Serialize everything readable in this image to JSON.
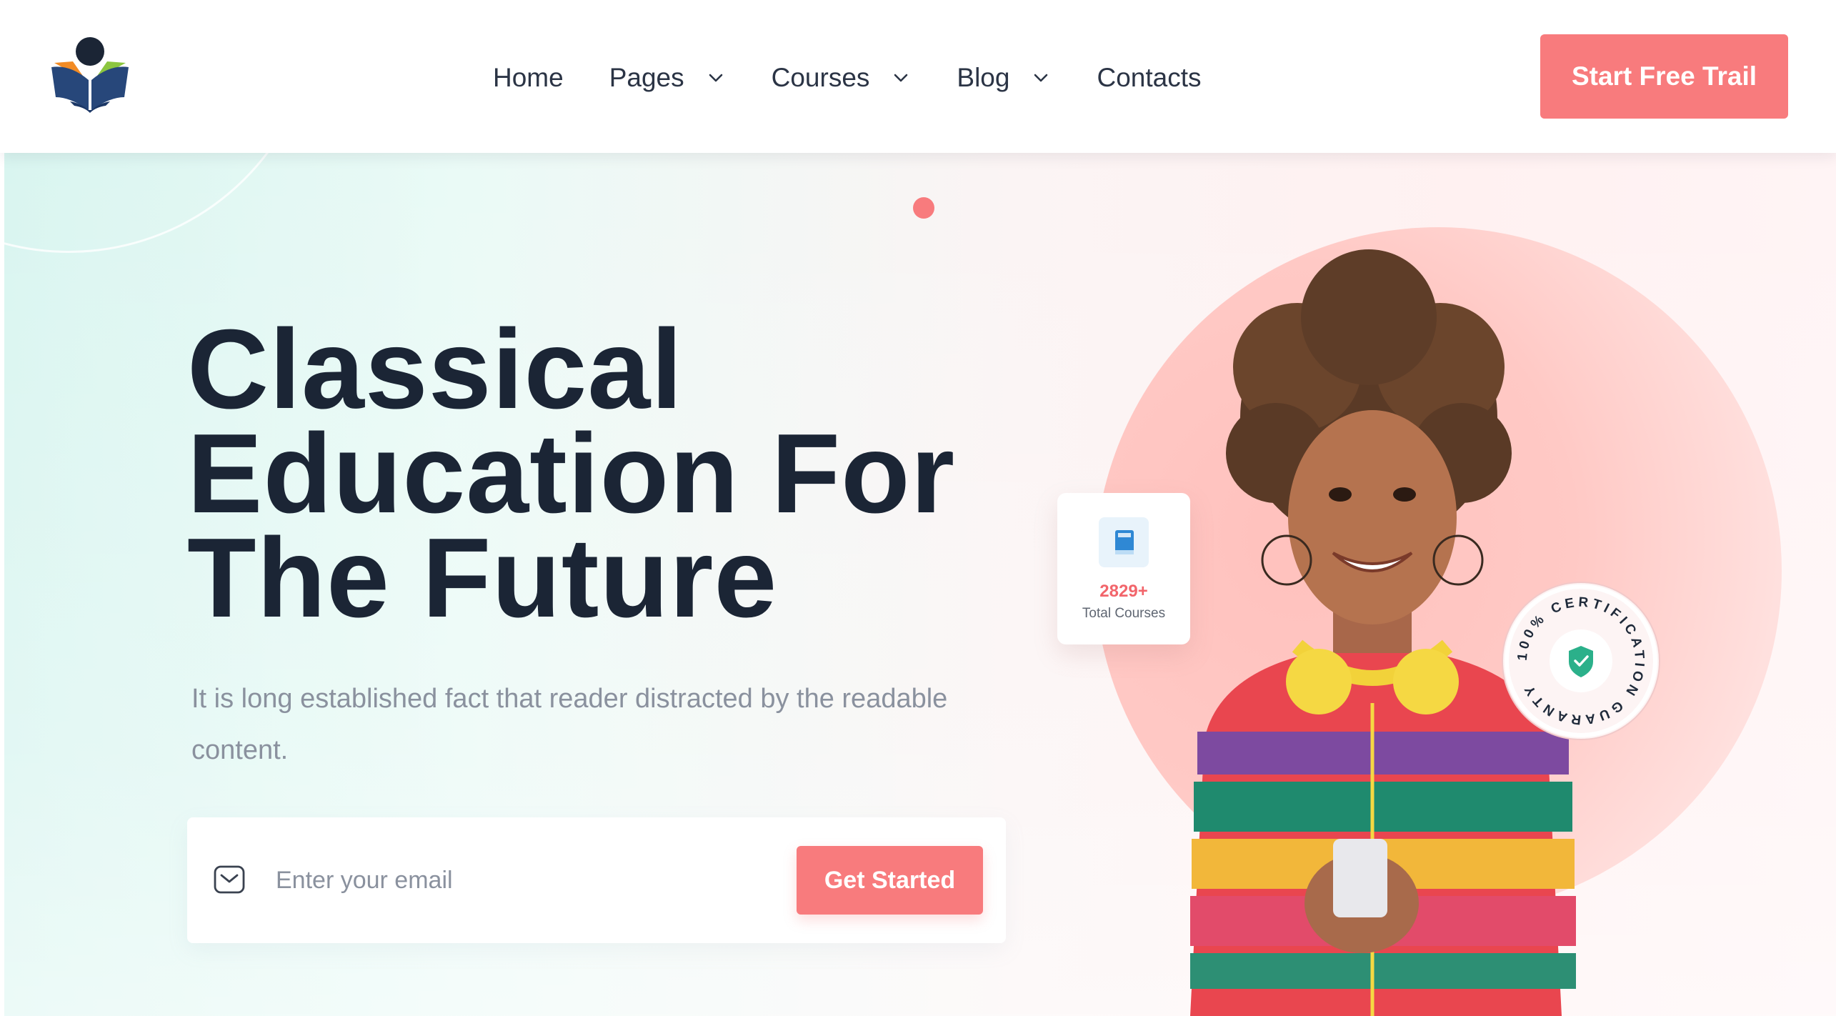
{
  "header": {
    "logo_icon": "open-book-reader-logo",
    "nav": [
      {
        "label": "Home",
        "has_dropdown": false
      },
      {
        "label": "Pages",
        "has_dropdown": true
      },
      {
        "label": "Courses",
        "has_dropdown": true
      },
      {
        "label": "Blog",
        "has_dropdown": true
      },
      {
        "label": "Contacts",
        "has_dropdown": false
      }
    ],
    "cta_label": "Start Free Trail"
  },
  "hero": {
    "title_lines": [
      "Classical",
      "Education For",
      "The Future"
    ],
    "subtitle": "It is long established fact that reader distracted by the readable content.",
    "email": {
      "placeholder": "Enter your email",
      "value": "",
      "button_label": "Get Started"
    },
    "stats_card": {
      "icon": "book-icon",
      "count": "2829+",
      "label": "Total Courses"
    },
    "badge": {
      "text": "100% CERTIFICATION GUARANTY",
      "icon": "shield-check-icon"
    }
  },
  "colors": {
    "accent": "#f87b7d",
    "heading": "#1b2535",
    "muted": "#8a919e",
    "hero_left": "#d9f5f0",
    "hero_right": "#fff1f1"
  }
}
